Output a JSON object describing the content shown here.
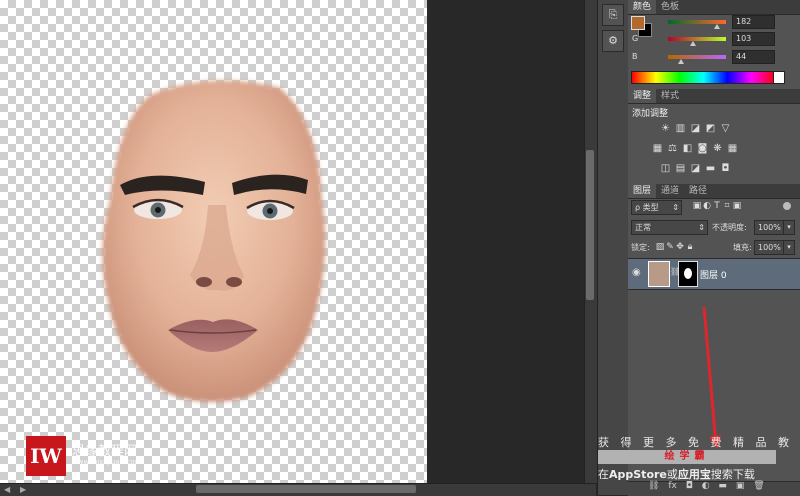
{
  "canvas": {
    "watermark_logo": "IW",
    "watermark_name": "思缘教程网",
    "watermark_url": "www.missyuan.com"
  },
  "color_panel": {
    "tabs": [
      "颜色",
      "色板"
    ],
    "active_tab": 0,
    "foreground_color": "#b3682c",
    "background_color": "#000000",
    "channels": [
      {
        "label": "R",
        "value": "182",
        "gradient": [
          "#00682c",
          "#ff682c"
        ]
      },
      {
        "label": "G",
        "value": "103",
        "gradient": [
          "#b6002c",
          "#b6ff2c"
        ]
      },
      {
        "label": "B",
        "value": "44",
        "gradient": [
          "#b66700",
          "#b667ff"
        ]
      }
    ]
  },
  "adjust_panel": {
    "tabs": [
      "调整",
      "样式"
    ],
    "active_tab": 0,
    "title": "添加调整",
    "icons": [
      "brightness-icon",
      "levels-icon",
      "curves-icon",
      "exposure-icon",
      "vibrance-icon",
      "hue-saturation-icon",
      "color-balance-icon",
      "black-white-icon",
      "photo-filter-icon",
      "channel-mixer-icon",
      "color-lookup-icon",
      "invert-icon",
      "posterize-icon",
      "threshold-icon",
      "gradient-map-icon",
      "selective-color-icon"
    ]
  },
  "layers_panel": {
    "tabs": [
      "图层",
      "通道",
      "路径"
    ],
    "active_tab": 0,
    "filter_label": "ρ 类型",
    "blend_mode": "正常",
    "opacity_label": "不透明度:",
    "opacity_value": "100%",
    "lock_label": "锁定:",
    "fill_label": "填充:",
    "fill_value": "100%",
    "layers": [
      {
        "name": "图层 0",
        "visible": true
      }
    ],
    "footer_icons": [
      "link-icon",
      "fx-icon",
      "mask-icon",
      "adjustment-icon",
      "folder-icon",
      "new-layer-icon",
      "trash-icon"
    ]
  },
  "overlay": {
    "line1": "获 得 更 多 免 费 精 品 教 程",
    "brand": "绘学霸",
    "line3_pre": "在",
    "line3_app": "AppStore",
    "line3_mid": "或",
    "line3_bold": "应用宝",
    "line3_post": "搜索下载"
  }
}
